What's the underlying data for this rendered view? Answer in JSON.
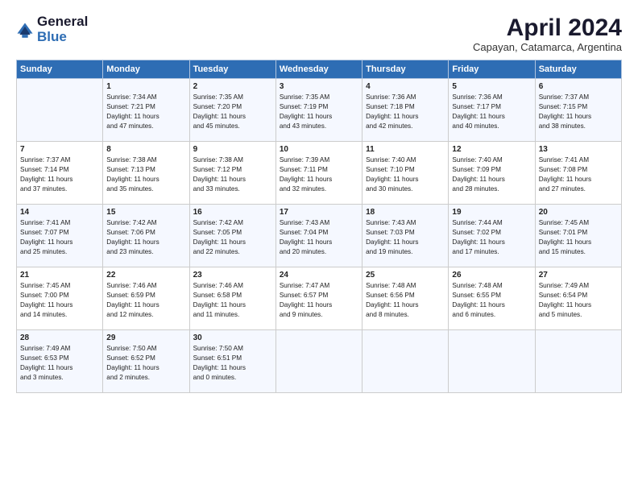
{
  "header": {
    "logo_general": "General",
    "logo_blue": "Blue",
    "month": "April 2024",
    "location": "Capayan, Catamarca, Argentina"
  },
  "weekdays": [
    "Sunday",
    "Monday",
    "Tuesday",
    "Wednesday",
    "Thursday",
    "Friday",
    "Saturday"
  ],
  "weeks": [
    [
      {
        "day": "",
        "sunrise": "",
        "sunset": "",
        "daylight": ""
      },
      {
        "day": "1",
        "sunrise": "Sunrise: 7:34 AM",
        "sunset": "Sunset: 7:21 PM",
        "daylight": "Daylight: 11 hours and 47 minutes."
      },
      {
        "day": "2",
        "sunrise": "Sunrise: 7:35 AM",
        "sunset": "Sunset: 7:20 PM",
        "daylight": "Daylight: 11 hours and 45 minutes."
      },
      {
        "day": "3",
        "sunrise": "Sunrise: 7:35 AM",
        "sunset": "Sunset: 7:19 PM",
        "daylight": "Daylight: 11 hours and 43 minutes."
      },
      {
        "day": "4",
        "sunrise": "Sunrise: 7:36 AM",
        "sunset": "Sunset: 7:18 PM",
        "daylight": "Daylight: 11 hours and 42 minutes."
      },
      {
        "day": "5",
        "sunrise": "Sunrise: 7:36 AM",
        "sunset": "Sunset: 7:17 PM",
        "daylight": "Daylight: 11 hours and 40 minutes."
      },
      {
        "day": "6",
        "sunrise": "Sunrise: 7:37 AM",
        "sunset": "Sunset: 7:15 PM",
        "daylight": "Daylight: 11 hours and 38 minutes."
      }
    ],
    [
      {
        "day": "7",
        "sunrise": "Sunrise: 7:37 AM",
        "sunset": "Sunset: 7:14 PM",
        "daylight": "Daylight: 11 hours and 37 minutes."
      },
      {
        "day": "8",
        "sunrise": "Sunrise: 7:38 AM",
        "sunset": "Sunset: 7:13 PM",
        "daylight": "Daylight: 11 hours and 35 minutes."
      },
      {
        "day": "9",
        "sunrise": "Sunrise: 7:38 AM",
        "sunset": "Sunset: 7:12 PM",
        "daylight": "Daylight: 11 hours and 33 minutes."
      },
      {
        "day": "10",
        "sunrise": "Sunrise: 7:39 AM",
        "sunset": "Sunset: 7:11 PM",
        "daylight": "Daylight: 11 hours and 32 minutes."
      },
      {
        "day": "11",
        "sunrise": "Sunrise: 7:40 AM",
        "sunset": "Sunset: 7:10 PM",
        "daylight": "Daylight: 11 hours and 30 minutes."
      },
      {
        "day": "12",
        "sunrise": "Sunrise: 7:40 AM",
        "sunset": "Sunset: 7:09 PM",
        "daylight": "Daylight: 11 hours and 28 minutes."
      },
      {
        "day": "13",
        "sunrise": "Sunrise: 7:41 AM",
        "sunset": "Sunset: 7:08 PM",
        "daylight": "Daylight: 11 hours and 27 minutes."
      }
    ],
    [
      {
        "day": "14",
        "sunrise": "Sunrise: 7:41 AM",
        "sunset": "Sunset: 7:07 PM",
        "daylight": "Daylight: 11 hours and 25 minutes."
      },
      {
        "day": "15",
        "sunrise": "Sunrise: 7:42 AM",
        "sunset": "Sunset: 7:06 PM",
        "daylight": "Daylight: 11 hours and 23 minutes."
      },
      {
        "day": "16",
        "sunrise": "Sunrise: 7:42 AM",
        "sunset": "Sunset: 7:05 PM",
        "daylight": "Daylight: 11 hours and 22 minutes."
      },
      {
        "day": "17",
        "sunrise": "Sunrise: 7:43 AM",
        "sunset": "Sunset: 7:04 PM",
        "daylight": "Daylight: 11 hours and 20 minutes."
      },
      {
        "day": "18",
        "sunrise": "Sunrise: 7:43 AM",
        "sunset": "Sunset: 7:03 PM",
        "daylight": "Daylight: 11 hours and 19 minutes."
      },
      {
        "day": "19",
        "sunrise": "Sunrise: 7:44 AM",
        "sunset": "Sunset: 7:02 PM",
        "daylight": "Daylight: 11 hours and 17 minutes."
      },
      {
        "day": "20",
        "sunrise": "Sunrise: 7:45 AM",
        "sunset": "Sunset: 7:01 PM",
        "daylight": "Daylight: 11 hours and 15 minutes."
      }
    ],
    [
      {
        "day": "21",
        "sunrise": "Sunrise: 7:45 AM",
        "sunset": "Sunset: 7:00 PM",
        "daylight": "Daylight: 11 hours and 14 minutes."
      },
      {
        "day": "22",
        "sunrise": "Sunrise: 7:46 AM",
        "sunset": "Sunset: 6:59 PM",
        "daylight": "Daylight: 11 hours and 12 minutes."
      },
      {
        "day": "23",
        "sunrise": "Sunrise: 7:46 AM",
        "sunset": "Sunset: 6:58 PM",
        "daylight": "Daylight: 11 hours and 11 minutes."
      },
      {
        "day": "24",
        "sunrise": "Sunrise: 7:47 AM",
        "sunset": "Sunset: 6:57 PM",
        "daylight": "Daylight: 11 hours and 9 minutes."
      },
      {
        "day": "25",
        "sunrise": "Sunrise: 7:48 AM",
        "sunset": "Sunset: 6:56 PM",
        "daylight": "Daylight: 11 hours and 8 minutes."
      },
      {
        "day": "26",
        "sunrise": "Sunrise: 7:48 AM",
        "sunset": "Sunset: 6:55 PM",
        "daylight": "Daylight: 11 hours and 6 minutes."
      },
      {
        "day": "27",
        "sunrise": "Sunrise: 7:49 AM",
        "sunset": "Sunset: 6:54 PM",
        "daylight": "Daylight: 11 hours and 5 minutes."
      }
    ],
    [
      {
        "day": "28",
        "sunrise": "Sunrise: 7:49 AM",
        "sunset": "Sunset: 6:53 PM",
        "daylight": "Daylight: 11 hours and 3 minutes."
      },
      {
        "day": "29",
        "sunrise": "Sunrise: 7:50 AM",
        "sunset": "Sunset: 6:52 PM",
        "daylight": "Daylight: 11 hours and 2 minutes."
      },
      {
        "day": "30",
        "sunrise": "Sunrise: 7:50 AM",
        "sunset": "Sunset: 6:51 PM",
        "daylight": "Daylight: 11 hours and 0 minutes."
      },
      {
        "day": "",
        "sunrise": "",
        "sunset": "",
        "daylight": ""
      },
      {
        "day": "",
        "sunrise": "",
        "sunset": "",
        "daylight": ""
      },
      {
        "day": "",
        "sunrise": "",
        "sunset": "",
        "daylight": ""
      },
      {
        "day": "",
        "sunrise": "",
        "sunset": "",
        "daylight": ""
      }
    ]
  ]
}
